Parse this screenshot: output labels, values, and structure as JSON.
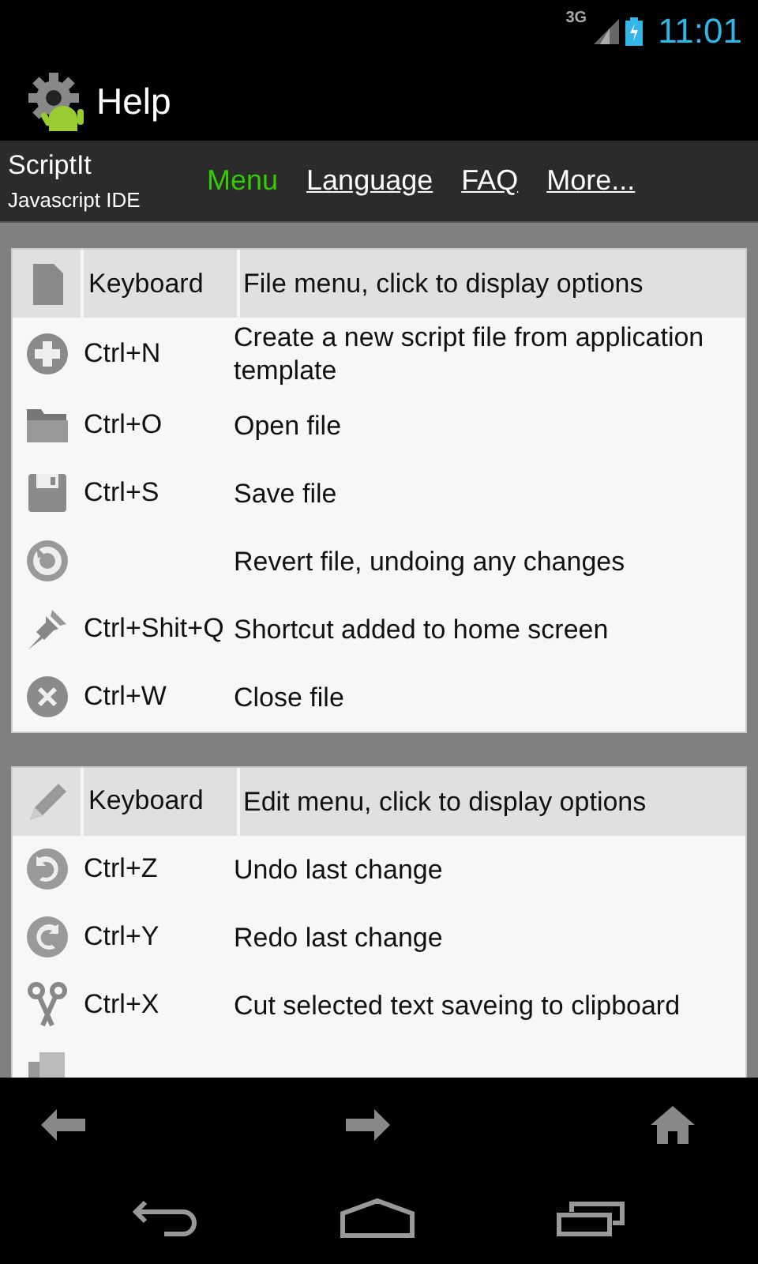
{
  "status_bar": {
    "network": "3G",
    "time": "11:01"
  },
  "action_bar": {
    "title": "Help"
  },
  "nav": {
    "app_name": "ScriptIt",
    "app_subtitle": "Javascript IDE",
    "links": [
      {
        "label": "Menu",
        "selected": true
      },
      {
        "label": "Language",
        "selected": false
      },
      {
        "label": "FAQ",
        "selected": false
      },
      {
        "label": "More...",
        "selected": false
      }
    ]
  },
  "sections": [
    {
      "header": {
        "kind": "file",
        "keyboard": "Keyboard",
        "description": "File menu, click to display options"
      },
      "rows": [
        {
          "kind": "new",
          "shortcut": "Ctrl+N",
          "description": "Create a new script file from application template"
        },
        {
          "kind": "open",
          "shortcut": "Ctrl+O",
          "description": "Open file"
        },
        {
          "kind": "save",
          "shortcut": "Ctrl+S",
          "description": "Save file"
        },
        {
          "kind": "revert",
          "description": "Revert file, undoing any changes"
        },
        {
          "kind": "pin",
          "shortcut": "Ctrl+Shit+Q",
          "description": "Shortcut added to home screen"
        },
        {
          "kind": "close",
          "shortcut": "Ctrl+W",
          "description": "Close file"
        }
      ]
    },
    {
      "header": {
        "kind": "edit",
        "keyboard": "Keyboard",
        "description": "Edit menu, click to display options"
      },
      "rows": [
        {
          "kind": "undo",
          "shortcut": "Ctrl+Z",
          "description": "Undo last change"
        },
        {
          "kind": "redo",
          "shortcut": "Ctrl+Y",
          "description": "Redo last change"
        },
        {
          "kind": "cut",
          "shortcut": "Ctrl+X",
          "description": "Cut selected text saveing to clipboard"
        },
        {
          "kind": "copy"
        }
      ]
    }
  ]
}
